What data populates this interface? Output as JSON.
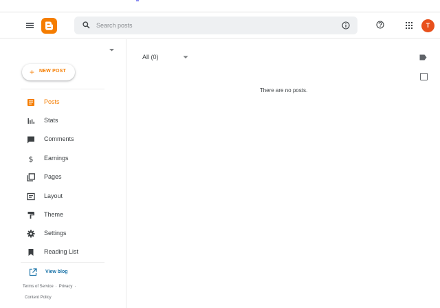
{
  "header": {
    "search": {
      "placeholder": "Search posts",
      "value": ""
    },
    "avatar_initial": "T",
    "colors": {
      "brand": "#f57d00",
      "avatar": "#e8501c"
    },
    "icons": [
      "menu-icon",
      "blogger-logo-icon",
      "search-icon",
      "info-icon",
      "help-icon",
      "apps-grid-icon"
    ]
  },
  "sidebar": {
    "new_post_label": "NEW POST",
    "items": [
      {
        "label": "Posts",
        "icon": "posts-icon",
        "active": true
      },
      {
        "label": "Stats",
        "icon": "stats-icon",
        "active": false
      },
      {
        "label": "Comments",
        "icon": "comments-icon",
        "active": false
      },
      {
        "label": "Earnings",
        "icon": "dollar-icon",
        "active": false
      },
      {
        "label": "Pages",
        "icon": "pages-icon",
        "active": false
      },
      {
        "label": "Layout",
        "icon": "layout-icon",
        "active": false
      },
      {
        "label": "Theme",
        "icon": "theme-icon",
        "active": false
      },
      {
        "label": "Settings",
        "icon": "settings-icon",
        "active": false
      },
      {
        "label": "Reading List",
        "icon": "bookmark-icon",
        "active": false
      }
    ],
    "view_blog_label": "View blog",
    "footer": {
      "terms": "Terms of Service",
      "separator": "·",
      "privacy": "Privacy",
      "content_policy": "Content Policy"
    }
  },
  "main": {
    "filter_label": "All (0)",
    "empty_message": "There are no posts."
  }
}
